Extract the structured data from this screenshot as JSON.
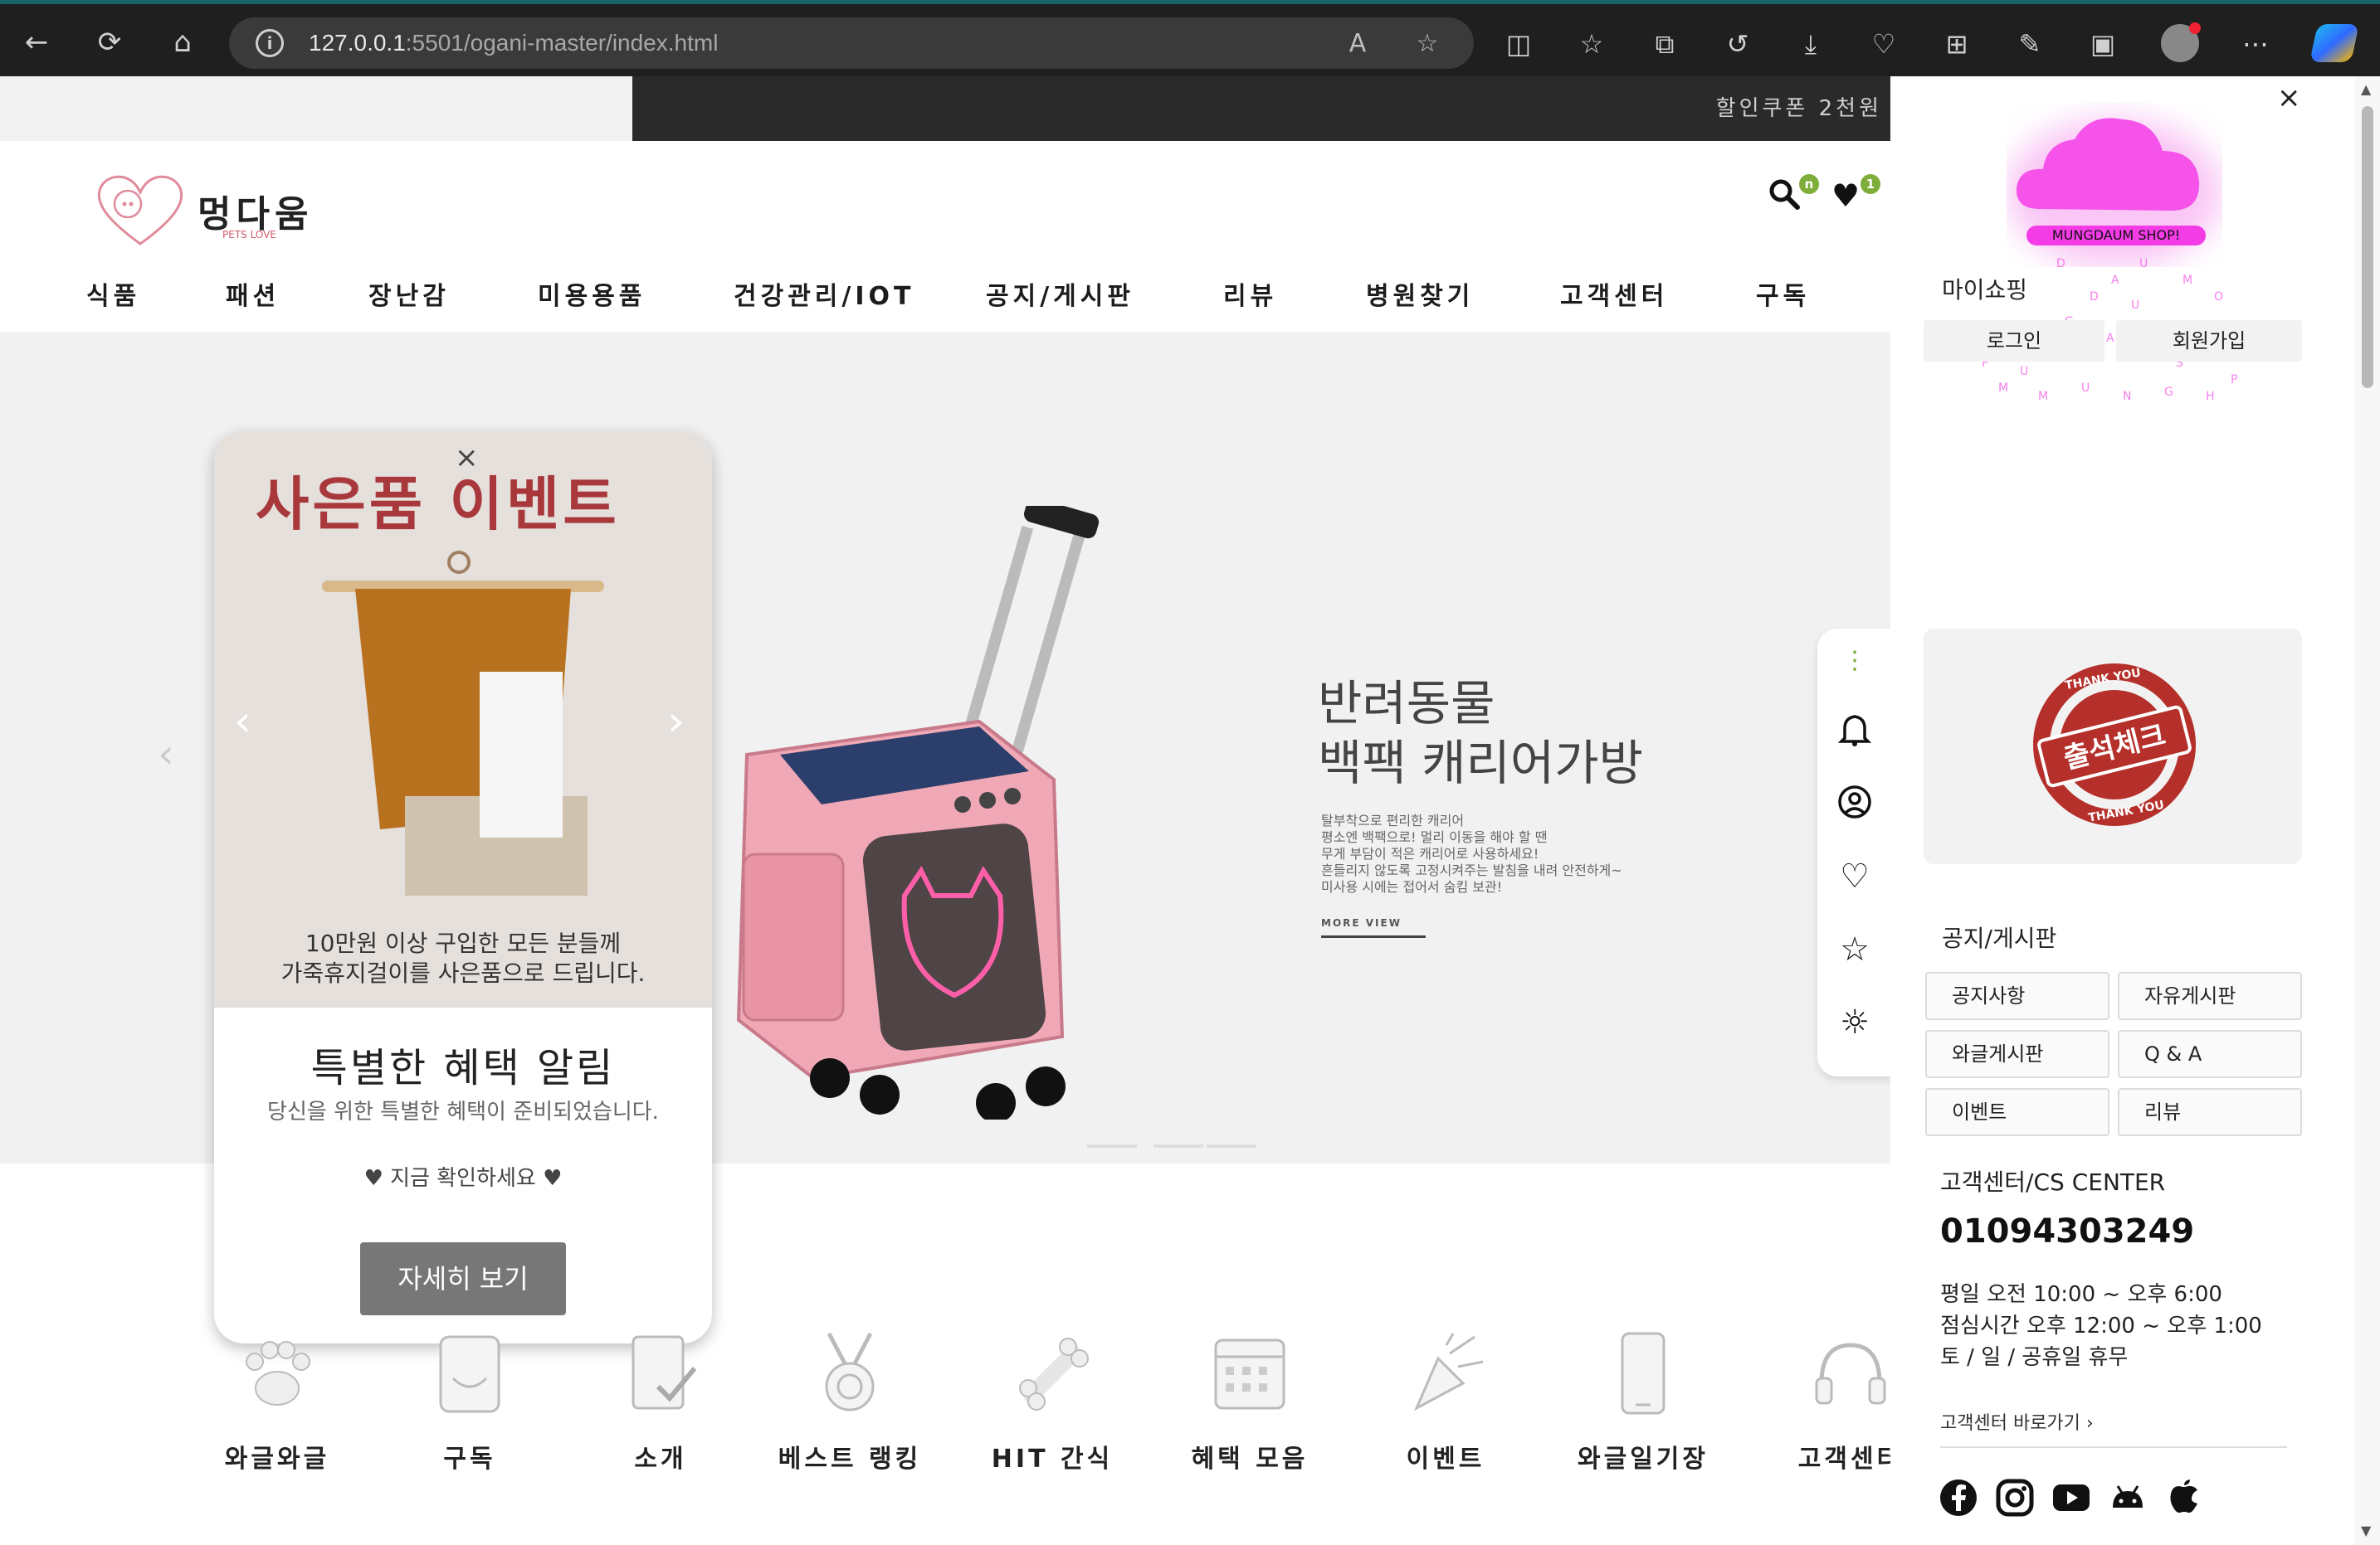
{
  "browser": {
    "url_host": "127.0.0.1",
    "url_rest": ":5501/ogani-master/index.html"
  },
  "site": {
    "promo_text": "할인쿠폰 2천원 ",
    "logo_name": "멍다움",
    "logo_sub": "PETS LOVE",
    "search_badge": "n",
    "wish_badge": "1",
    "menu": [
      "식품",
      "패션",
      "장난감",
      "미용용품",
      "건강관리/IOT",
      "공지/게시판",
      "리뷰",
      "병원찾기",
      "고객센터",
      "구독"
    ]
  },
  "hero": {
    "title_line1": "반려동물",
    "title_line2": "백팩 캐리어가방",
    "desc": [
      "탈부착으로 편리한 캐리어",
      "평소엔 백팩으로! 멀리 이동을 해야 할 땐",
      "무게 부담이 적은 캐리어로 사용하세요!",
      "흔들리지 않도록 고정시켜주는 발침을 내려 안전하게~",
      "미사용 시에는 접어서 숨킴 보관!"
    ],
    "more": "MORE VIEW"
  },
  "popup": {
    "event_title": "사은품 이벤트",
    "close": "×",
    "caption_line1": "10만원 이상 구입한 모든 분들께",
    "caption_line2": "가죽휴지걸이를 사은품으로 드립니다.",
    "heading": "특별한 혜택 알림",
    "sub": "당신을 위한 특별한 혜택이 준비되었습니다.",
    "check": "♥ 지금 확인하세요 ♥",
    "button": "자세히 보기"
  },
  "categories": [
    "와글와글",
    "구독",
    "소개",
    "베스트 랭킹",
    "HIT 간식",
    "혜택 모음",
    "이벤트",
    "와글일기장",
    "고객센터"
  ],
  "sidebar": {
    "close": "×",
    "cloud_tag": "MUNGDAUM SHOP!",
    "my_shopping": "마이쇼핑",
    "login": "로그인",
    "signup": "회원가입",
    "stamp_text": "출석체크",
    "stamp_ring": "THANK YOU",
    "notice_title": "공지/게시판",
    "board_buttons": [
      "공지사항",
      "자유게시판",
      "와글게시판",
      "Q & A",
      "이벤트",
      "리뷰"
    ],
    "cs_title": "고객센터/CS CENTER",
    "phone": "01094303249",
    "hours": [
      "평일 오전 10:00 ~ 오후 6:00",
      "점심시간 오후 12:00 ~ 오후 1:00",
      "토 / 일 / 공휴일 휴무"
    ],
    "cs_link": "고객센터 바로가기 ›"
  },
  "colors": {
    "accent_green": "#7fad39",
    "popup_red": "#a8383c",
    "cloud_pink": "#f553ea",
    "stamp_red": "#b5302b"
  }
}
